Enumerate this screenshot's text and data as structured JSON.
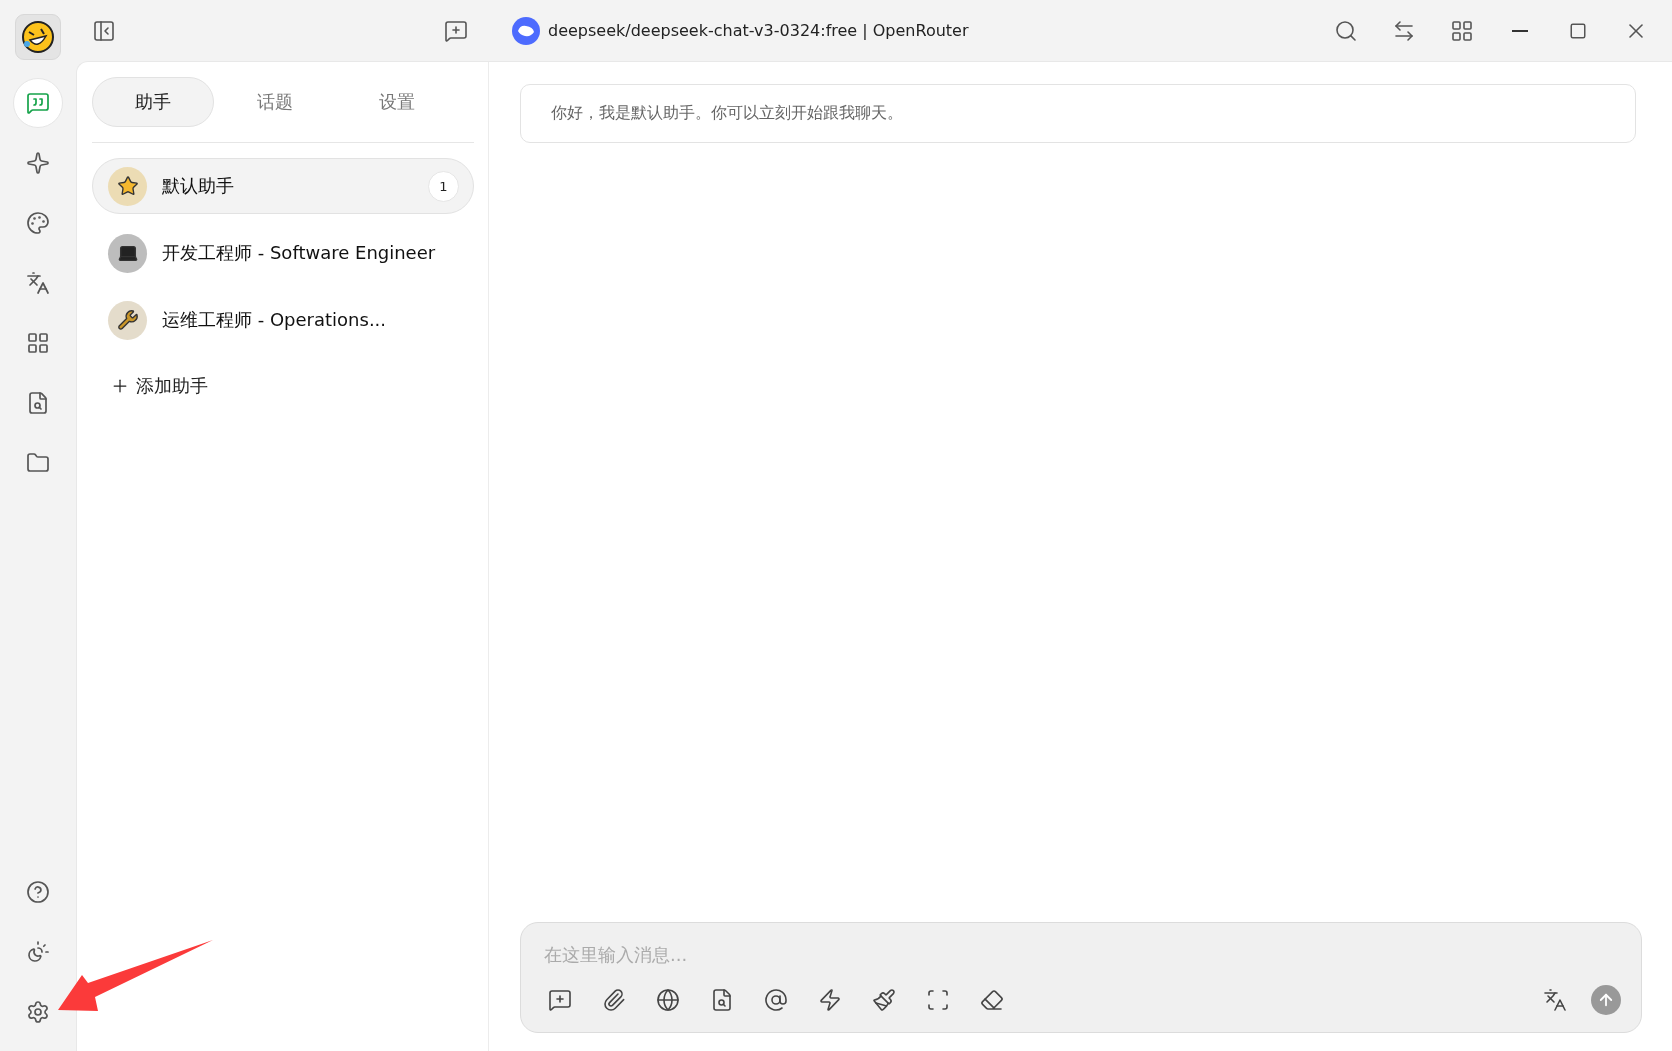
{
  "window": {
    "title": "deepseek/deepseek-chat-v3-0324:free | OpenRouter"
  },
  "rail": {
    "items": [
      {
        "kind": "chat",
        "selected": true
      },
      {
        "kind": "sparkle",
        "selected": false
      },
      {
        "kind": "palette",
        "selected": false
      },
      {
        "kind": "translate",
        "selected": false
      },
      {
        "kind": "apps",
        "selected": false
      },
      {
        "kind": "file-search",
        "selected": false
      },
      {
        "kind": "folder",
        "selected": false
      }
    ],
    "bottom": [
      {
        "kind": "help"
      },
      {
        "kind": "theme"
      },
      {
        "kind": "settings"
      }
    ]
  },
  "tabs": [
    {
      "label": "助手",
      "selected": true
    },
    {
      "label": "话题",
      "selected": false
    },
    {
      "label": "设置",
      "selected": false
    }
  ],
  "assistants": [
    {
      "kind": "star",
      "name": "默认助手",
      "selected": true,
      "count": "1"
    },
    {
      "kind": "laptop",
      "name": "开发工程师 - Software Engineer",
      "selected": false
    },
    {
      "kind": "tools",
      "name": "运维工程师 - Operations...",
      "selected": false
    }
  ],
  "add_assistant": {
    "label": "添加助手"
  },
  "welcome_message": "你好，我是默认助手。你可以立刻开始跟我聊天。",
  "composer": {
    "placeholder": "在这里输入消息...",
    "tools": [
      {
        "kind": "new-topic"
      },
      {
        "kind": "attach"
      },
      {
        "kind": "web"
      },
      {
        "kind": "knowledge"
      },
      {
        "kind": "mention"
      },
      {
        "kind": "quick"
      },
      {
        "kind": "clear"
      },
      {
        "kind": "expand"
      },
      {
        "kind": "eraser"
      }
    ]
  },
  "annotation": {
    "kind": "arrow"
  }
}
